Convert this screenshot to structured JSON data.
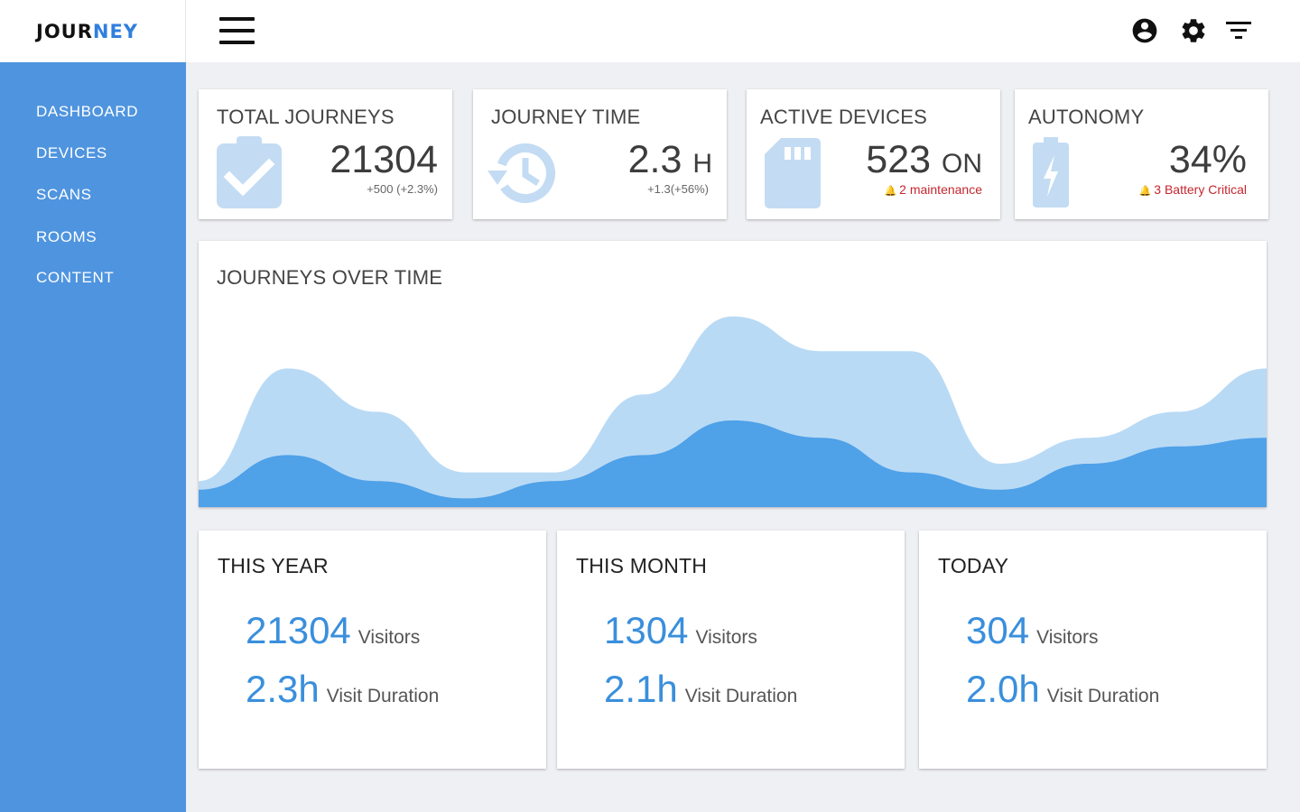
{
  "brand": {
    "part1": "JOUR",
    "part2": "NEY"
  },
  "header": {
    "icons": [
      "account-circle-icon",
      "gear-icon",
      "filter-icon"
    ]
  },
  "sidebar": {
    "items": [
      {
        "label": "DASHBOARD"
      },
      {
        "label": "DEVICES"
      },
      {
        "label": "SCANS"
      },
      {
        "label": "ROOMS"
      },
      {
        "label": "CONTENT"
      }
    ]
  },
  "stats": [
    {
      "title": "TOTAL JOURNEYS",
      "icon": "clipboard-check-icon",
      "value": "21304",
      "unit": "",
      "sub": "+500 (+2.3%)"
    },
    {
      "title": "JOURNEY TIME",
      "icon": "history-icon",
      "value": "2.3",
      "unit": "H",
      "sub": "+1.3(+56%)"
    },
    {
      "title": "ACTIVE DEVICES",
      "icon": "sd-card-icon",
      "value": "523",
      "unit": "ON",
      "alert": "2 maintenance"
    },
    {
      "title": "AUTONOMY",
      "icon": "battery-charging-icon",
      "value": "34%",
      "unit": "",
      "alert": "3 Battery Critical"
    }
  ],
  "chart": {
    "title": "JOURNEYS OVER TIME"
  },
  "chart_data": {
    "type": "area",
    "title": "JOURNEYS OVER TIME",
    "x": [
      0,
      1,
      2,
      3,
      4,
      5,
      6,
      7,
      8,
      9,
      10,
      11,
      12
    ],
    "series": [
      {
        "values": [
          3,
          16,
          11,
          4,
          4,
          13,
          22,
          18,
          18,
          5,
          8,
          11,
          16
        ]
      },
      {
        "values": [
          2,
          6,
          3,
          1,
          3,
          6,
          10,
          8,
          4,
          2,
          5,
          7,
          8
        ]
      }
    ],
    "ylim": [
      0,
      25
    ],
    "colors": [
      "#b9daf5",
      "#4fa1e8"
    ],
    "grid": false
  },
  "summaries": [
    {
      "title": "THIS YEAR",
      "visitors": "21304",
      "visitors_label": "Visitors",
      "duration": "2.3h",
      "duration_label": "Visit Duration"
    },
    {
      "title": "THIS MONTH",
      "visitors": "1304",
      "visitors_label": "Visitors",
      "duration": "2.1h",
      "duration_label": "Visit Duration"
    },
    {
      "title": "TODAY",
      "visitors": "304",
      "visitors_label": "Visitors",
      "duration": "2.0h",
      "duration_label": "Visit Duration"
    }
  ],
  "colors": {
    "sidebar": "#4f94df",
    "accent": "#3a8fdc",
    "alert": "#c6262e",
    "icon_light": "#c3dcf3"
  }
}
